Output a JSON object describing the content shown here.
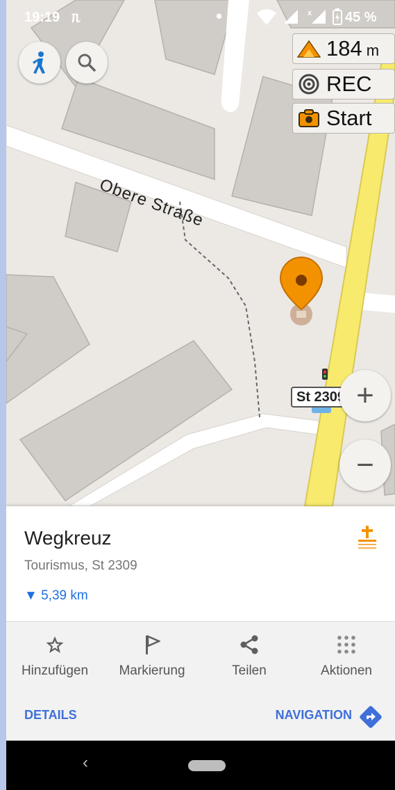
{
  "status_bar": {
    "time": "19:19",
    "vpn_symbol": "ᥰ",
    "battery": "45 %",
    "icons": [
      "notification-dot",
      "location-icon",
      "wifi-icon",
      "signal-icon",
      "signal-x-icon",
      "battery-icon"
    ]
  },
  "map": {
    "street_name": "Obere Straße",
    "road_ref": "St 2309",
    "widgets": {
      "altitude_value": "184",
      "altitude_unit": "m",
      "rec_label": "REC",
      "start_label": "Start"
    },
    "zoom_in_symbol": "+",
    "zoom_out_symbol": "−"
  },
  "poi": {
    "title": "Wegkreuz",
    "subtitle": "Tourismus, St 2309",
    "distance": "5,39 km",
    "distance_arrow": "▼"
  },
  "actions": [
    {
      "label": "Hinzufügen",
      "icon": "star-icon"
    },
    {
      "label": "Markierung",
      "icon": "flag-icon"
    },
    {
      "label": "Teilen",
      "icon": "share-icon"
    },
    {
      "label": "Aktionen",
      "icon": "grid-dots-icon"
    }
  ],
  "links": {
    "details": "DETAILS",
    "navigation": "NAVIGATION"
  },
  "nav_bar": {
    "back_symbol": "‹"
  },
  "colors": {
    "accent_blue": "#3f6fd8",
    "distance_blue": "#1e6fe0",
    "marker_orange": "#f39200",
    "main_road_yellow": "#f7ea6d",
    "building_gray": "#d0ccc8",
    "map_background": "#ece8e4"
  }
}
